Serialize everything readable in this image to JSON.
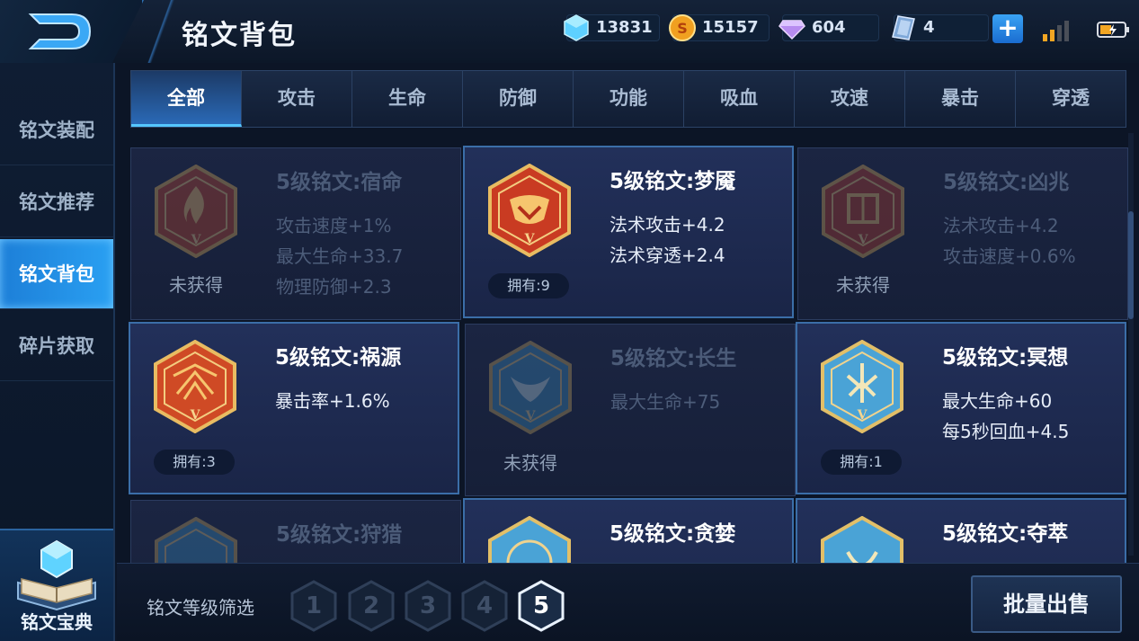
{
  "header": {
    "title": "铭文背包",
    "back_icon": "back-arrow-icon",
    "currencies": [
      {
        "name": "diamond",
        "icon": "diamond-icon",
        "value": "13831"
      },
      {
        "name": "gold",
        "icon": "gold-coin-icon",
        "value": "15157"
      },
      {
        "name": "gem",
        "icon": "purple-gem-icon",
        "value": "604"
      },
      {
        "name": "card",
        "icon": "card-icon",
        "value": "4"
      }
    ],
    "plus_label": "+"
  },
  "sidebar": {
    "items": [
      {
        "label": "铭文装配",
        "active": false
      },
      {
        "label": "铭文推荐",
        "active": false
      },
      {
        "label": "铭文背包",
        "active": true
      },
      {
        "label": "碎片获取",
        "active": false
      }
    ],
    "codex_label": "铭文宝典"
  },
  "tabs": [
    {
      "label": "全部",
      "active": true
    },
    {
      "label": "攻击",
      "active": false
    },
    {
      "label": "生命",
      "active": false
    },
    {
      "label": "防御",
      "active": false
    },
    {
      "label": "功能",
      "active": false
    },
    {
      "label": "吸血",
      "active": false
    },
    {
      "label": "攻速",
      "active": false
    },
    {
      "label": "暴击",
      "active": false
    },
    {
      "label": "穿透",
      "active": false
    }
  ],
  "cards": [
    {
      "name": "5级铭文:宿命",
      "stats": [
        "攻击速度+1%",
        "最大生命+33.7",
        "物理防御+2.3"
      ],
      "status": "未获得",
      "owned": false,
      "color": "#c0452a"
    },
    {
      "name": "5级铭文:梦魇",
      "stats": [
        "法术攻击+4.2",
        "法术穿透+2.4"
      ],
      "status": "拥有:9",
      "owned": true,
      "color": "#c93b22"
    },
    {
      "name": "5级铭文:凶兆",
      "stats": [
        "法术攻击+4.2",
        "攻击速度+0.6%"
      ],
      "status": "未获得",
      "owned": false,
      "color": "#b83a28"
    },
    {
      "name": "5级铭文:祸源",
      "stats": [
        "暴击率+1.6%"
      ],
      "status": "拥有:3",
      "owned": true,
      "color": "#cf4a25"
    },
    {
      "name": "5级铭文:长生",
      "stats": [
        "最大生命+75"
      ],
      "status": "未获得",
      "owned": false,
      "color": "#3a8fc2"
    },
    {
      "name": "5级铭文:冥想",
      "stats": [
        "最大生命+60",
        "每5秒回血+4.5"
      ],
      "status": "拥有:1",
      "owned": true,
      "color": "#4aa3d6"
    },
    {
      "name": "5级铭文:狩猎",
      "stats": [],
      "status": "",
      "owned": false,
      "color": "#3a8fc2"
    },
    {
      "name": "5级铭文:贪婪",
      "stats": [],
      "status": "",
      "owned": true,
      "color": "#4aa3d6"
    },
    {
      "name": "5级铭文:夺萃",
      "stats": [],
      "status": "",
      "owned": true,
      "color": "#4aa3d6"
    }
  ],
  "footer": {
    "filter_label": "铭文等级筛选",
    "levels": [
      "1",
      "2",
      "3",
      "4",
      "5"
    ],
    "active_level": "5",
    "sell_label": "批量出售"
  }
}
